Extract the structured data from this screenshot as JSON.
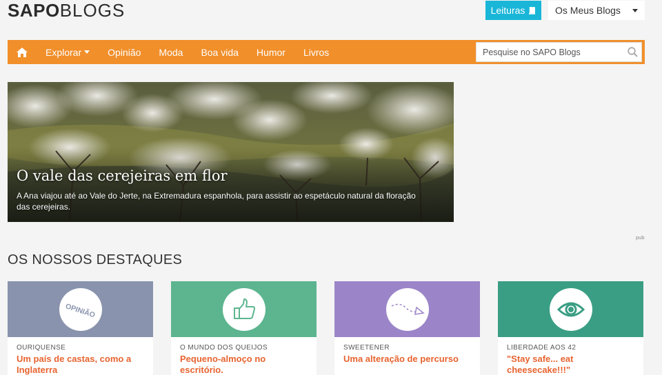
{
  "header": {
    "logo_bold": "SAPO",
    "logo_thin": "BLOGS",
    "leituras_label": "Leituras",
    "my_blogs_label": "Os Meus Blogs"
  },
  "nav": {
    "items": [
      "Explorar",
      "Opinião",
      "Moda",
      "Boa vida",
      "Humor",
      "Livros"
    ],
    "search_placeholder": "Pesquise no SAPO Blogs"
  },
  "hero": {
    "title": "O vale das cerejeiras em flor",
    "description": "A Ana viajou até ao Vale do Jerte, na Extremadura espanhola, para assistir ao espetáculo natural da floração das cerejeiras."
  },
  "pub_label": "pub",
  "section_title": "OS NOSSOS DESTAQUES",
  "cards": [
    {
      "blog": "OURIQUENSE",
      "post": "Um país de castas, como a Inglaterra",
      "color": "#8993ad",
      "icon": "opiniao-badge-icon",
      "badge_text": "OPINIÃO"
    },
    {
      "blog": "O MUNDO DOS QUEIJOS",
      "post": "Pequeno-almoço no escritório.",
      "color": "#5cb58f",
      "icon": "thumbs-up-icon"
    },
    {
      "blog": "SWEETENER",
      "post": "Uma alteração de percurso",
      "color": "#9b85c8",
      "icon": "paper-plane-trail-icon"
    },
    {
      "blog": "LIBERDADE AOS 42",
      "post": "\"Stay safe... eat cheesecake!!!\"",
      "color": "#3a9e84",
      "icon": "eye-icon"
    }
  ],
  "colors": {
    "nav_bg": "#f18f2b",
    "leituras_bg": "#19b6d8",
    "post_title": "#e7632f"
  }
}
